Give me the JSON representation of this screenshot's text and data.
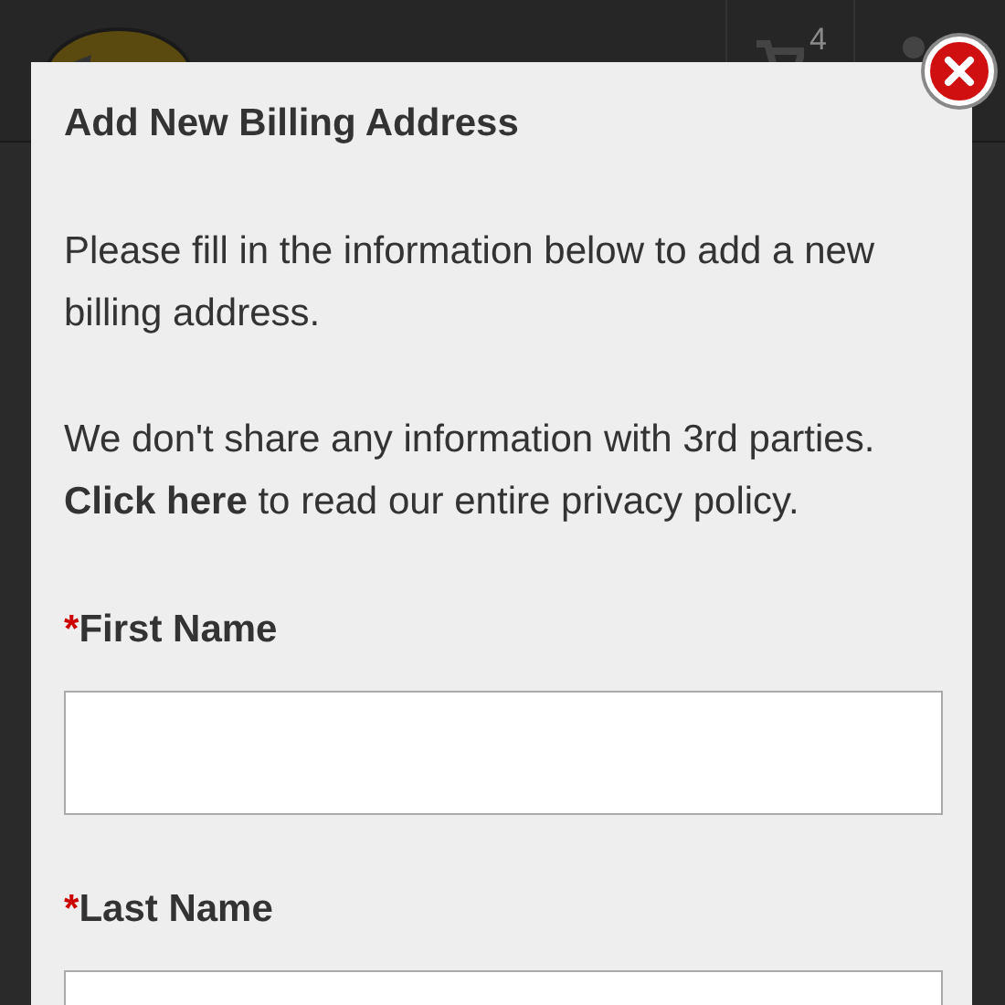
{
  "header": {
    "cart_count": "4"
  },
  "dialog": {
    "title": "Add New Billing Address",
    "paragraphs": [
      "Please fill in the information below to add a new billing address.",
      "We don't share any information with 3rd parties. **Click here** to read our entire privacy policy."
    ],
    "fields": [
      {
        "label": "First Name",
        "required": true,
        "required_mark": "*"
      },
      {
        "label": "Last Name",
        "required": true,
        "required_mark": "*"
      }
    ]
  }
}
